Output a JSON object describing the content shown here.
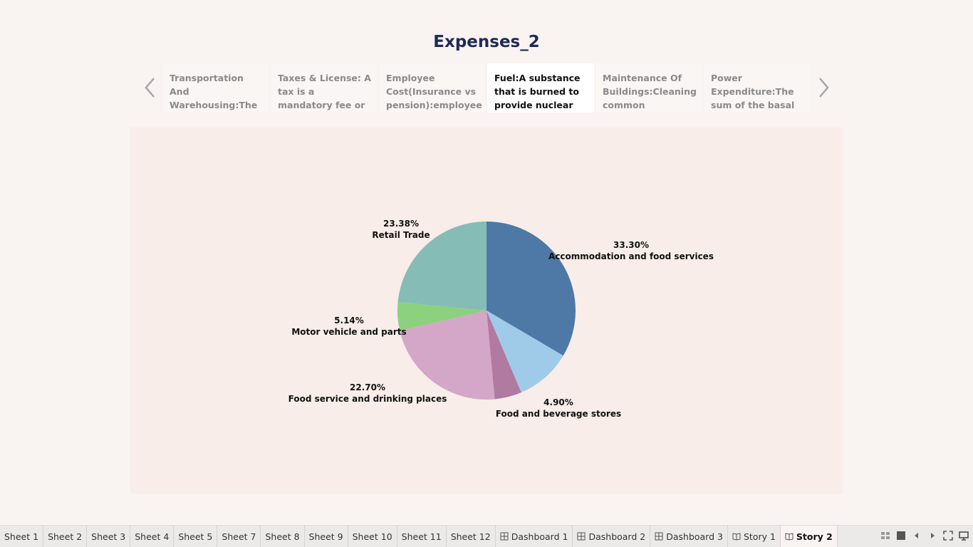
{
  "story": {
    "title": "Expenses_2"
  },
  "story_points": [
    {
      "text": "Transportation And Warehousing:The transportation and"
    },
    {
      "text": "Taxes & License: A tax is a mandatory fee or financial"
    },
    {
      "text": "Employee Cost(Insurance vs pension):employee"
    },
    {
      "text": "Fuel:A substance that is burned to provide nuclear"
    },
    {
      "text": "Maintenance Of Buildings:Cleaning common"
    },
    {
      "text": "Power Expenditure:The sum of the basal"
    }
  ],
  "active_point": 3,
  "chart_data": {
    "type": "pie",
    "slices": [
      {
        "label": "Accommodation and food services",
        "value": 33.3,
        "display": "33.30%",
        "color": "#4e79a7"
      },
      {
        "label": "",
        "value": 10.1,
        "display": "",
        "color": "#a0cbe8"
      },
      {
        "label": "Food and beverage stores",
        "value": 4.9,
        "display": "4.90%",
        "color": "#b07aa1"
      },
      {
        "label": "Food service and drinking places",
        "value": 22.7,
        "display": "22.70%",
        "color": "#d4a6c8"
      },
      {
        "label": "Motor vehicle and parts",
        "value": 5.14,
        "display": "5.14%",
        "color": "#8cd17d"
      },
      {
        "label": "Retail Trade",
        "value": 23.38,
        "display": "23.38%",
        "color": "#86bcb6"
      }
    ]
  },
  "tabs": [
    {
      "label": "Sheet 1",
      "icon": ""
    },
    {
      "label": "Sheet 2",
      "icon": ""
    },
    {
      "label": "Sheet 3",
      "icon": ""
    },
    {
      "label": "Sheet 4",
      "icon": ""
    },
    {
      "label": "Sheet 5",
      "icon": ""
    },
    {
      "label": "Sheet 7",
      "icon": ""
    },
    {
      "label": "Sheet 8",
      "icon": ""
    },
    {
      "label": "Sheet 9",
      "icon": ""
    },
    {
      "label": "Sheet 10",
      "icon": ""
    },
    {
      "label": "Sheet 11",
      "icon": ""
    },
    {
      "label": "Sheet 12",
      "icon": ""
    },
    {
      "label": "Dashboard 1",
      "icon": "dashboard-icon"
    },
    {
      "label": "Dashboard 2",
      "icon": "dashboard-icon"
    },
    {
      "label": "Dashboard 3",
      "icon": "dashboard-icon"
    },
    {
      "label": "Story 1",
      "icon": "story-icon"
    },
    {
      "label": "Story 2",
      "icon": "story-icon",
      "active": true
    }
  ],
  "controls": [
    "show-sheet-sorter-icon",
    "show-tabs-icon",
    "prev-sheet-icon",
    "next-sheet-icon",
    "fullscreen-icon",
    "presentation-mode-icon"
  ]
}
